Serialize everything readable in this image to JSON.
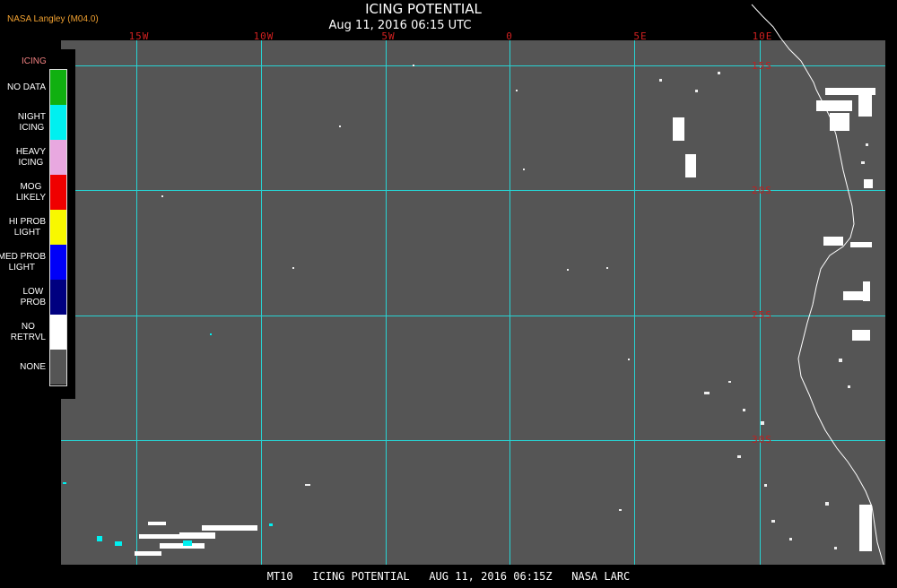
{
  "header": {
    "source": "NASA Langley (M04.0)",
    "title": "ICING POTENTIAL",
    "subtitle": "Aug 11, 2016 06:15 UTC"
  },
  "longitude_labels": [
    "15W",
    "10W",
    "5W",
    "0",
    "5E",
    "10E"
  ],
  "latitude_labels": [
    "15S",
    "20S",
    "25S",
    "30S"
  ],
  "legend": {
    "title": "ICING",
    "items": [
      {
        "label": "NO DATA",
        "color": "#10b010"
      },
      {
        "label": "NIGHT\nICING",
        "color": "#00f0f0"
      },
      {
        "label": "HEAVY\nICING",
        "color": "#e8a8e0"
      },
      {
        "label": "MOG\nLIKELY",
        "color": "#f00000"
      },
      {
        "label": "HI PROB\nLIGHT",
        "color": "#f8f800"
      },
      {
        "label": "MED PROB\nLIGHT",
        "color": "#0000f8"
      },
      {
        "label": "LOW\nPROB",
        "color": "#000080"
      },
      {
        "label": "NO\nRETRVL",
        "color": "#ffffff"
      },
      {
        "label": "NONE",
        "color": "#555555"
      }
    ]
  },
  "footer": {
    "text": "MT10   ICING POTENTIAL   AUG 11, 2016 06:15Z   NASA LARC"
  },
  "colors": {
    "background": "#555555",
    "grid": "#27d3d3",
    "coastline": "#ffffff",
    "lon_label": "#d02020",
    "lat_label": "#c02020",
    "source_label": "#f0a030"
  }
}
